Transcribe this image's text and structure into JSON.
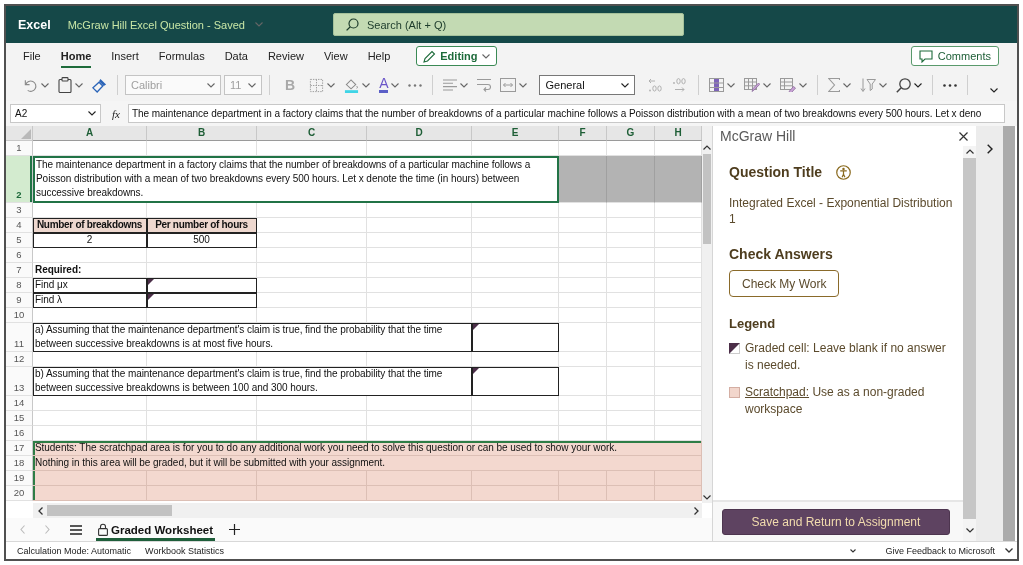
{
  "title_bar": {
    "app_name": "Excel",
    "document_title": "McGraw Hill Excel Question - Saved",
    "search": {
      "placeholder": "Search (Alt + Q)"
    }
  },
  "ribbon_tabs": [
    {
      "label": "File",
      "selected": false
    },
    {
      "label": "Home",
      "selected": true
    },
    {
      "label": "Insert",
      "selected": false
    },
    {
      "label": "Formulas",
      "selected": false
    },
    {
      "label": "Data",
      "selected": false
    },
    {
      "label": "Review",
      "selected": false
    },
    {
      "label": "View",
      "selected": false
    },
    {
      "label": "Help",
      "selected": false
    }
  ],
  "mode_button": "Editing",
  "comments_button": "Comments",
  "toolbar": {
    "font": {
      "value": "Calibri",
      "disabled": true
    },
    "font_size": {
      "value": "11",
      "disabled": true
    },
    "bold": {
      "label": "B",
      "disabled": true
    },
    "font_color": {
      "label": "A"
    },
    "number_format": {
      "value": "General",
      "disabled": false
    }
  },
  "formula_bar": {
    "name_box": "A2",
    "function_symbol": "fx",
    "formula": "The maintenance department in a factory claims that the number of breakdowns of a particular machine follows a Poisson distribution with a mean of two breakdowns every 500 hours. Let x deno"
  },
  "sheet": {
    "columns": [
      "A",
      "B",
      "C",
      "D",
      "E",
      "F",
      "G",
      "H"
    ],
    "rows": [
      {
        "number": "1",
        "kind": "blank",
        "selected": false
      },
      {
        "number": "2",
        "kind": "intro",
        "selected": true,
        "text": "The maintenance department in a factory claims that the number of breakdowns of a particular machine follows a Poisson distribution with a mean of two breakdowns every 500 hours. Let x denote the time (in hours) between successive breakdowns."
      },
      {
        "number": "3",
        "kind": "blank",
        "selected": false
      },
      {
        "number": "4",
        "kind": "header_pair",
        "selected": false,
        "cells": [
          "Number of breakdowns",
          "Per number of hours"
        ]
      },
      {
        "number": "5",
        "kind": "value_pair",
        "selected": false,
        "cells": [
          "2",
          "500"
        ]
      },
      {
        "number": "6",
        "kind": "blank",
        "selected": false
      },
      {
        "number": "7",
        "kind": "label",
        "selected": false,
        "text": "Required:"
      },
      {
        "number": "8",
        "kind": "answer",
        "selected": false,
        "text": "Find μx"
      },
      {
        "number": "9",
        "kind": "answer",
        "selected": false,
        "text": "Find λ"
      },
      {
        "number": "10",
        "kind": "blank",
        "selected": false
      },
      {
        "number": "11",
        "kind": "question",
        "selected": false,
        "text": "a) Assuming that the maintenance department's claim is true, find the probability that the time between successive breakdowns is at most five hours."
      },
      {
        "number": "12",
        "kind": "blank",
        "selected": false
      },
      {
        "number": "13",
        "kind": "question",
        "selected": false,
        "text": "b) Assuming that the maintenance department's claim is true, find the probability that the time between successive breakdowns is between 100 and 300 hours."
      },
      {
        "number": "14",
        "kind": "blank",
        "selected": false
      },
      {
        "number": "15",
        "kind": "blank",
        "selected": false
      },
      {
        "number": "16",
        "kind": "blank",
        "selected": false
      },
      {
        "number": "17",
        "kind": "scratch_note",
        "selected": false,
        "text": "Students: The scratchpad area is for you to do any additional work you need to solve this question or can be used to show your work."
      },
      {
        "number": "18",
        "kind": "scratch_note",
        "selected": false,
        "text": "Nothing in this area will be graded, but it will be submitted with your assignment."
      },
      {
        "number": "19",
        "kind": "scratch",
        "selected": false
      },
      {
        "number": "20",
        "kind": "scratch",
        "selected": false
      }
    ]
  },
  "sheet_tabs": [
    {
      "label": "Graded Worksheet",
      "selected": true,
      "locked": true
    }
  ],
  "task_pane": {
    "title": "McGraw Hill",
    "sections": [
      {
        "kind": "question",
        "heading": "Question Title",
        "text": "Integrated Excel - Exponential Distribution 1"
      },
      {
        "kind": "check",
        "heading": "Check Answers",
        "button": "Check My Work"
      },
      {
        "kind": "legend",
        "heading": "Legend",
        "items": [
          {
            "kind": "graded",
            "text": "Graded cell: Leave blank if no answer is needed."
          },
          {
            "kind": "scratchpad",
            "link": "Scratchpad:",
            "text": "Use as a non-graded workspace"
          }
        ]
      }
    ],
    "save_button": "Save and Return to Assignment"
  },
  "status_bar": {
    "items": [
      "Calculation Mode: Automatic",
      "Workbook Statistics"
    ],
    "feedback": "Give Feedback to Microsoft"
  }
}
